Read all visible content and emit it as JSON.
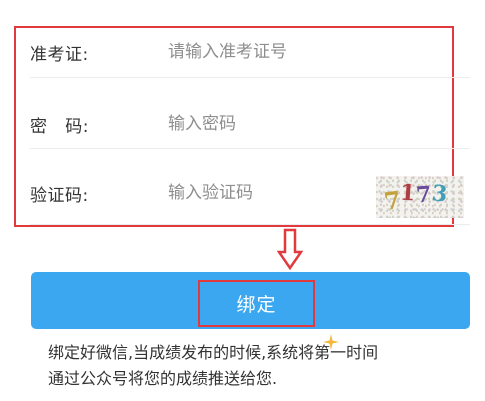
{
  "form": {
    "ticket": {
      "label": "准考证:",
      "placeholder": "请输入准考证号"
    },
    "password": {
      "label": "密   码:",
      "placeholder": "输入密码"
    },
    "captcha": {
      "label": "验证码:",
      "placeholder": "输入验证码",
      "image_text": [
        "7",
        "1",
        "7",
        "3"
      ]
    }
  },
  "bind_button": {
    "label": "绑定"
  },
  "info": {
    "line1": "绑定好微信,当成绩发布的时候,系统将第一时间",
    "line2": "通过公众号将您的成绩推送给您."
  },
  "colors": {
    "accent": "#3aa7f0",
    "highlight": "#e03a3e"
  },
  "icons": {
    "arrow": "down-arrow-icon",
    "sparkle": "sparkle-icon"
  }
}
